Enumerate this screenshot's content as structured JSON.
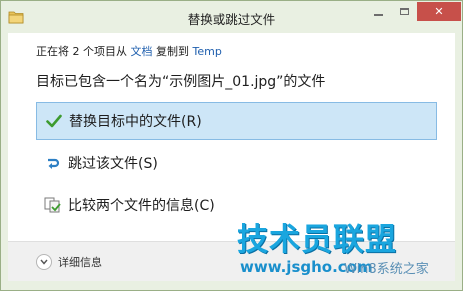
{
  "window": {
    "title": "替换或跳过文件"
  },
  "copy_status": {
    "prefix": "正在将 2 个项目从",
    "source": "文档",
    "middle": "复制到",
    "destination": "Temp"
  },
  "conflict_message": "目标已包含一个名为“示例图片_01.jpg”的文件",
  "options": [
    {
      "label": "替换目标中的文件(R)",
      "icon": "checkmark-icon",
      "selected": true
    },
    {
      "label": "跳过该文件(S)",
      "icon": "skip-arrow-icon",
      "selected": false
    },
    {
      "label": "比较两个文件的信息(C)",
      "icon": "compare-files-icon",
      "selected": false
    }
  ],
  "footer": {
    "details_label": "详细信息"
  },
  "watermark": {
    "brand": "技术员联盟",
    "url": "www.jsgho.com",
    "suffix": "Win8系统之家"
  },
  "colors": {
    "frame": "#e9f0e2",
    "selected_bg": "#cde6f7",
    "selected_border": "#87bbe4",
    "link": "#1f5fae",
    "close_button": "#c7504a"
  }
}
